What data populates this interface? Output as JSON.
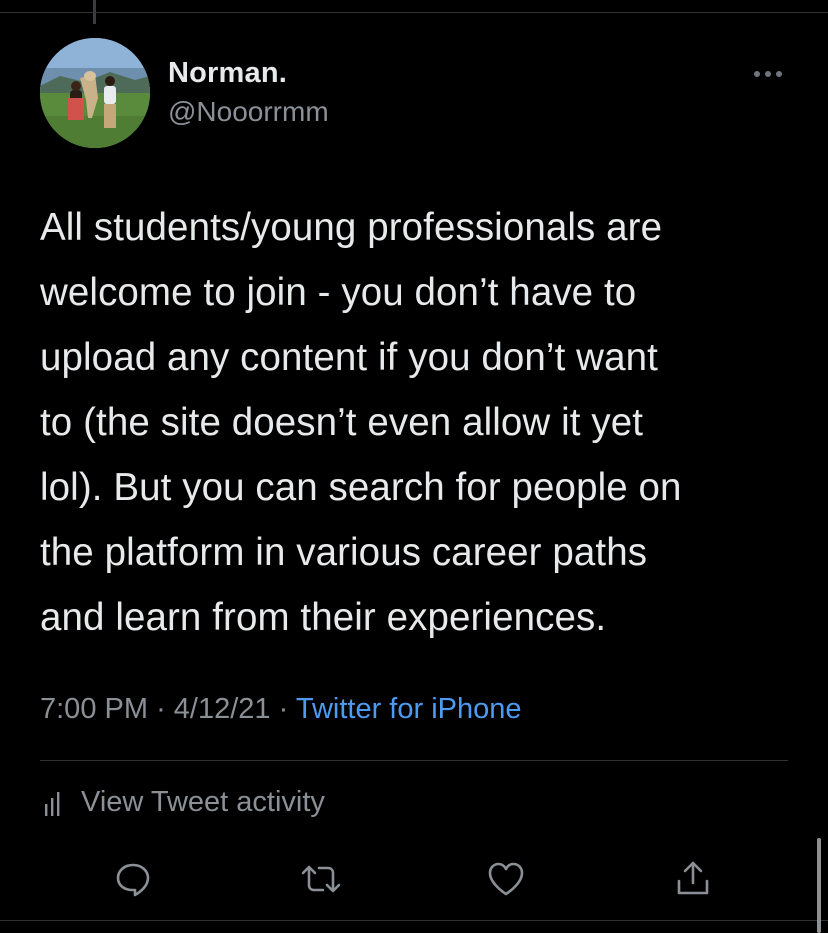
{
  "user": {
    "name": "Norman.",
    "handle": "@Nooorrmm"
  },
  "tweet": {
    "text": "All students/young professionals are\nwelcome to join - you don’t have to\nupload any content if you don’t want\nto (the site doesn’t even allow it yet\nlol). But you can search for people on\nthe platform in various career paths\nand learn from their experiences.",
    "time": "7:00 PM",
    "date": "4/12/21",
    "separator": "·",
    "source": "Twitter for iPhone"
  },
  "activity": {
    "label": "View Tweet activity",
    "icon": "bar-chart-icon"
  },
  "actions": [
    {
      "name": "reply",
      "icon": "reply-icon"
    },
    {
      "name": "retweet",
      "icon": "retweet-icon"
    },
    {
      "name": "like",
      "icon": "heart-icon"
    },
    {
      "name": "share",
      "icon": "share-icon"
    }
  ],
  "colors": {
    "background": "#000000",
    "text": "#e7e9ea",
    "secondary": "#8b9096",
    "link": "#4c9bf0",
    "divider": "#2f3336"
  }
}
